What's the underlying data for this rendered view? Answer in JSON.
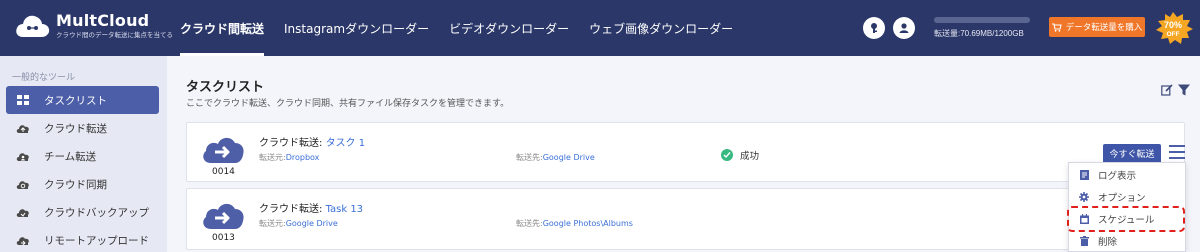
{
  "app": {
    "brand": "MultCloud",
    "tagline": "クラウド間のデータ転送に集点を当てる"
  },
  "nav": {
    "items": [
      {
        "label": "クラウド間転送",
        "active": true
      },
      {
        "label": "Instagramダウンローダー",
        "active": false
      },
      {
        "label": "ビデオダウンローダー",
        "active": false
      },
      {
        "label": "ウェブ画像ダウンローダー",
        "active": false
      }
    ]
  },
  "header": {
    "traffic_text": "転送量:70.69MB/1200GB",
    "traffic_fraction": 0.0001,
    "buy_label": "データ転送量を購入",
    "badge_text": "70%",
    "badge_sub": "OFF",
    "icons": [
      "key-icon",
      "user-icon"
    ]
  },
  "sidebar": {
    "group_label": "一般的なツール",
    "items": [
      {
        "label": "タスクリスト",
        "icon": "grid-icon",
        "active": true
      },
      {
        "label": "クラウド転送",
        "icon": "cloud-upload-icon",
        "active": false
      },
      {
        "label": "チーム転送",
        "icon": "team-cloud-icon",
        "active": false
      },
      {
        "label": "クラウド同期",
        "icon": "cloud-sync-icon",
        "active": false
      },
      {
        "label": "クラウドバックアップ",
        "icon": "cloud-backup-icon",
        "active": false
      },
      {
        "label": "リモートアップロード",
        "icon": "cloud-remote-icon",
        "active": false
      }
    ]
  },
  "main": {
    "title": "タスクリスト",
    "description": "ここでクラウド転送、クラウド同期、共有ファイル保存タスクを管理できます。",
    "tasks": [
      {
        "number": "0014",
        "type_label": "クラウド転送:",
        "name": "タスク 1",
        "source_label": "転送元:",
        "source": "Dropbox",
        "dest_label": "転送先:",
        "dest": "Google Drive",
        "status": "成功",
        "action_label": "今すぐ転送"
      },
      {
        "number": "0013",
        "type_label": "クラウド転送:",
        "name": "Task 13",
        "source_label": "転送元:",
        "source": "Google Drive",
        "dest_label": "転送先:",
        "dest": "Google Photos\\Albums"
      }
    ]
  },
  "dropdown": {
    "items": [
      {
        "label": "ログ表示",
        "icon": "log-icon"
      },
      {
        "label": "オプション",
        "icon": "gear-icon"
      },
      {
        "label": "スケジュール",
        "icon": "calendar-icon",
        "highlighted": true
      },
      {
        "label": "削除",
        "icon": "trash-icon"
      }
    ]
  },
  "colors": {
    "topbar": "#2b3768",
    "accent": "#4d5ea8",
    "buy": "#f0762a",
    "success": "#38b97f",
    "highlight": "#e0201a",
    "link": "#3a6fd6"
  }
}
